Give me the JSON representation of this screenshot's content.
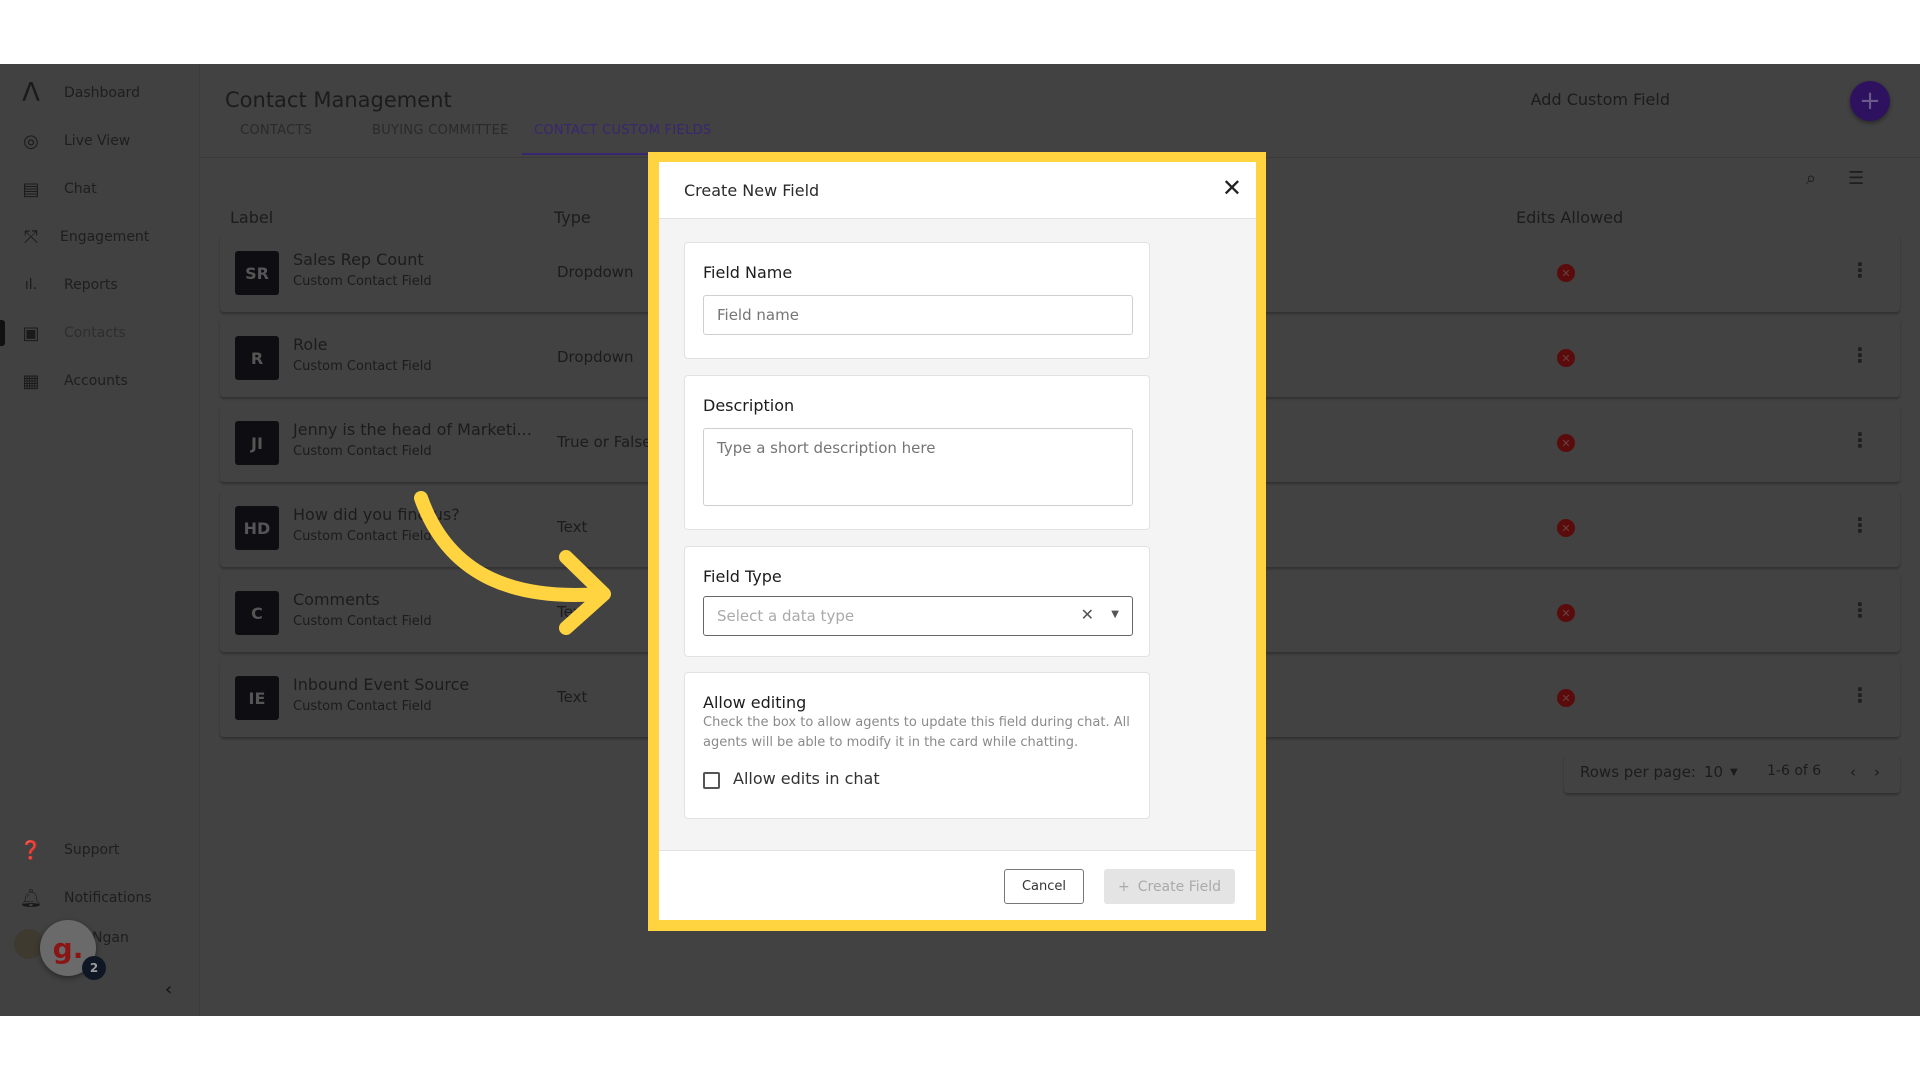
{
  "sidebar": {
    "items": [
      {
        "label": "Dashboard",
        "icon": "logo-icon"
      },
      {
        "label": "Live View",
        "icon": "live-view-icon"
      },
      {
        "label": "Chat",
        "icon": "chat-icon"
      },
      {
        "label": "Engagement",
        "icon": "engagement-icon"
      },
      {
        "label": "Reports",
        "icon": "bar-chart-icon"
      },
      {
        "label": "Contacts",
        "icon": "contacts-icon",
        "active": true
      },
      {
        "label": "Accounts",
        "icon": "building-icon"
      }
    ],
    "bottom": [
      {
        "label": "Support",
        "icon": "help-icon"
      },
      {
        "label": "Notifications",
        "icon": "bell-icon"
      }
    ],
    "user_name": "Ngan",
    "chat_widget_letter": "g.",
    "chat_badge": "2"
  },
  "header": {
    "title": "Contact Management",
    "tabs": [
      "CONTACTS",
      "BUYING COMMITTEE",
      "CONTACT CUSTOM FIELDS"
    ],
    "active_tab": "CONTACT CUSTOM FIELDS",
    "add_label": "Add Custom Field",
    "accent": "#3b1f6b"
  },
  "table": {
    "columns": [
      "Label",
      "Type",
      "Edits Allowed"
    ],
    "rows": [
      {
        "initials": "SR",
        "label": "Sales Rep Count",
        "sub": "Custom Contact Field",
        "type": "Dropdown",
        "edits": false
      },
      {
        "initials": "R",
        "label": "Role",
        "sub": "Custom Contact Field",
        "type": "Dropdown",
        "edits": false
      },
      {
        "initials": "JI",
        "label": "Jenny is the head of Marketi...",
        "sub": "Custom Contact Field",
        "type": "True or False",
        "edits": false
      },
      {
        "initials": "HD",
        "label": "How did you find us?",
        "sub": "Custom Contact Field",
        "type": "Text",
        "edits": false
      },
      {
        "initials": "C",
        "label": "Comments",
        "sub": "Custom Contact Field",
        "type": "Text",
        "edits": false
      },
      {
        "initials": "IE",
        "label": "Inbound Event Source",
        "sub": "Custom Contact Field",
        "type": "Text",
        "edits": false
      }
    ],
    "pagination": {
      "rows_label": "Rows per page:",
      "rows_value": "10",
      "range": "1-6 of 6"
    }
  },
  "modal": {
    "title": "Create New Field",
    "field_name": {
      "label": "Field Name",
      "placeholder": "Field name",
      "value": ""
    },
    "description": {
      "label": "Description",
      "placeholder": "Type a short description here",
      "value": ""
    },
    "field_type": {
      "label": "Field Type",
      "placeholder": "Select a data type"
    },
    "allow_editing": {
      "label": "Allow editing",
      "help": "Check the box to allow agents to update this field during chat. All agents will be able to modify it in the card while chatting.",
      "checkbox_label": "Allow edits in chat",
      "checked": false
    },
    "cancel": "Cancel",
    "create": "Create Field",
    "highlight_color": "#ffd440"
  }
}
